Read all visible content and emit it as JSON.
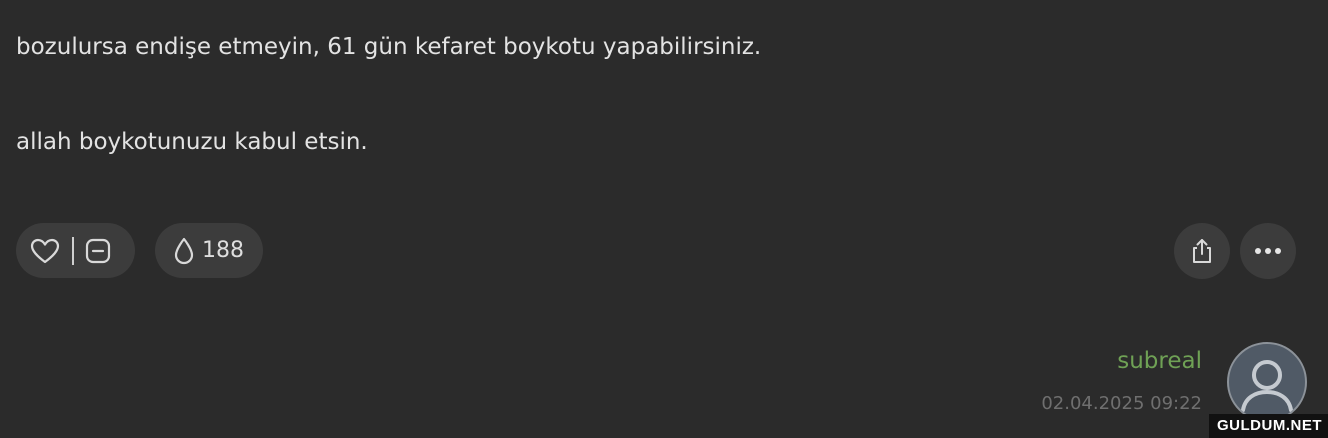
{
  "post": {
    "line1": "bozulursa endişe etmeyin, 61 gün kefaret boykotu yapabilirsiniz.",
    "line2": "allah boykotunuzu kabul etsin."
  },
  "actions": {
    "like_icon": "heart-icon",
    "dislike_icon": "minus-square-icon",
    "drop_icon": "drop-icon",
    "drop_count": "188",
    "share_icon": "share-icon",
    "more_icon": "ellipsis-icon"
  },
  "author": {
    "name": "subreal",
    "date": "02.04.2025 09:22",
    "name_color": "#6fa155"
  },
  "watermark": "GULDUM.NET"
}
